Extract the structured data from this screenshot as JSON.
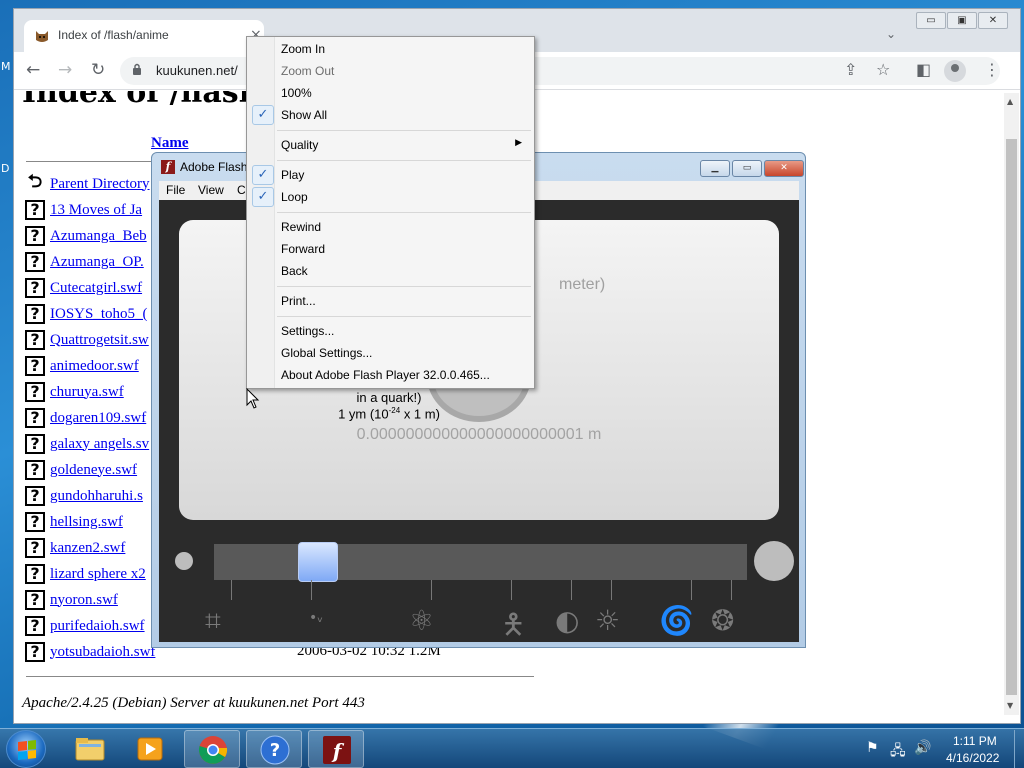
{
  "desktop": {
    "edge_letters": [
      "M",
      "D"
    ]
  },
  "browser": {
    "tab_title": "Index of /flash/anime",
    "url": "kuukunen.net/",
    "icons": [
      "back-icon",
      "forward-icon",
      "reload-icon",
      "lock-icon",
      "share-icon",
      "star-icon",
      "sidebar-icon",
      "profile-icon",
      "menu-icon"
    ]
  },
  "page": {
    "heading": "Index of /flash/anime",
    "column_name": "Name",
    "parent": "Parent Directory",
    "files": [
      "13 Moves of Ja",
      "Azumanga_Beb",
      "Azumanga_OP.",
      "Cutecatgirl.swf",
      "IOSYS_toho5_(",
      "Quattrogetsit.sw",
      "animedoor.swf",
      "churuya.swf",
      "dogaren109.swf",
      "galaxy angels.sv",
      "goldeneye.swf",
      "gundohharuhi.s",
      "hellsing.swf",
      "kanzen2.swf",
      "lizard sphere x2",
      "nyoron.swf",
      "purifedaioh.swf",
      "yotsubadaioh.swf"
    ],
    "last_row_meta": "2006-03-02 10:32  1.2M",
    "footer": "Apache/2.4.25 (Debian) Server at kuukunen.net Port 443"
  },
  "flash": {
    "title": "Adobe Flash",
    "menu": [
      "File",
      "View",
      "Co"
    ],
    "screen_label_partial": "meter)",
    "caption_line1": "in a quark!)",
    "caption_line2": "1 ym (10",
    "caption_exp": "-24",
    "caption_line2_tail": " x 1 m)",
    "decimal": "0.000000000000000000000001 m",
    "slider_position_fraction": 0.17
  },
  "context_menu": {
    "items": [
      {
        "label": "Zoom In",
        "checked": false,
        "disabled": false
      },
      {
        "label": "Zoom Out",
        "checked": false,
        "disabled": true
      },
      {
        "label": "100%",
        "checked": false,
        "disabled": false
      },
      {
        "label": "Show All",
        "checked": true,
        "disabled": false
      },
      {
        "label": "Quality",
        "checked": false,
        "disabled": false,
        "submenu": true
      },
      {
        "label": "Play",
        "checked": true,
        "disabled": false
      },
      {
        "label": "Loop",
        "checked": true,
        "disabled": false
      },
      {
        "label": "Rewind",
        "checked": false,
        "disabled": false
      },
      {
        "label": "Forward",
        "checked": false,
        "disabled": false
      },
      {
        "label": "Back",
        "checked": false,
        "disabled": false
      },
      {
        "label": "Print...",
        "checked": false,
        "disabled": false
      },
      {
        "label": "Settings...",
        "checked": false,
        "disabled": false
      },
      {
        "label": "Global Settings...",
        "checked": false,
        "disabled": false
      },
      {
        "label": "About Adobe Flash Player 32.0.0.465...",
        "checked": false,
        "disabled": false
      }
    ]
  },
  "taskbar": {
    "apps": [
      "explorer-icon",
      "media-player-icon",
      "chrome-icon",
      "help-icon",
      "flash-player-icon"
    ],
    "time": "1:11 PM",
    "date": "4/16/2022"
  },
  "colors": {
    "link": "#0000ee",
    "taskbar": "#1f5e96",
    "checked_box": "#e6f0fa",
    "flash_icon": "#8b1a1a"
  }
}
